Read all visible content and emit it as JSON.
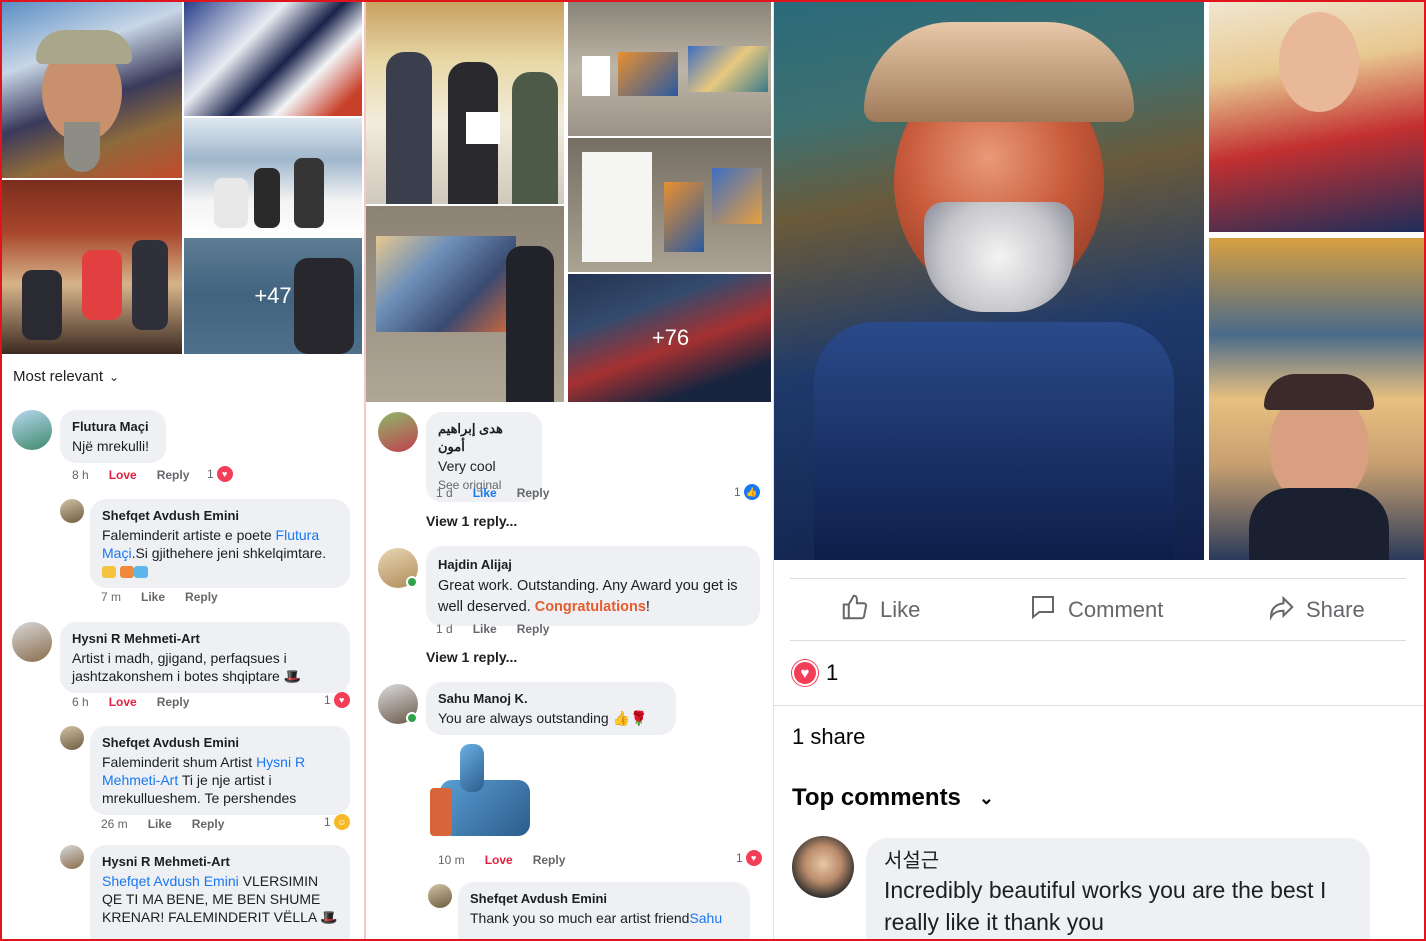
{
  "panel1": {
    "overlay_count": "+47",
    "sort_label": "Most relevant",
    "comments": [
      {
        "name": "Flutura Maçi",
        "text": "Një mrekulli!",
        "time": "8 h",
        "action1": "Love",
        "action2": "Reply",
        "reactions": "1"
      },
      {
        "name": "Shefqet Avdush Emini",
        "text_pre": "Faleminderit artiste e poete ",
        "mention": "Flutura Maçi",
        "text_post": ".Si gjithehere jeni shkelqimtare.",
        "time": "7 m",
        "action1": "Like",
        "action2": "Reply"
      },
      {
        "name": "Hysni R Mehmeti-Art",
        "text": "Artist i madh, gjigand, perfaqsues i jashtzakonshem i botes shqiptare",
        "time": "6 h",
        "action1": "Love",
        "action2": "Reply",
        "reactions": "1"
      },
      {
        "name": "Shefqet Avdush Emini",
        "text_pre": "Faleminderit shum Artist ",
        "mention": "Hysni R Mehmeti-Art",
        "text_post": " Ti je nje artist i mrekullueshem.",
        "text_tail": "Te pershendes",
        "time": "26 m",
        "action1": "Like",
        "action2": "Reply",
        "reactions": "1"
      },
      {
        "name": "Hysni R Mehmeti-Art",
        "mention": "Shefqet Avdush Emini",
        "text_post": " VLERSIMIN QE TI MA BENE, ME BEN SHUME KRENAR! FALEMINDERIT VËLLA"
      }
    ]
  },
  "panel2": {
    "overlay_count": "+76",
    "comments": [
      {
        "name": "هدى إبراهيم أمون",
        "text": "Very cool",
        "see": "See original",
        "time": "1 d",
        "action1": "Like",
        "action2": "Reply",
        "reactions": "1"
      },
      {
        "name": "Hajdin Alijaj",
        "text_pre": "Great work. Outstanding. Any Award you get is well deserved. ",
        "highlight": "Congratulations",
        "text_post": "!",
        "time": "1 d",
        "action1": "Like",
        "action2": "Reply"
      },
      {
        "name": "Sahu Manoj K.",
        "text": "You are always outstanding",
        "time": "10 m",
        "action1": "Love",
        "action2": "Reply",
        "reactions": "1"
      },
      {
        "name": "Shefqet Avdush Emini",
        "text_pre": "Thank you so much ear artist friend",
        "mention": "Sahu"
      }
    ],
    "view_reply": "View 1 reply..."
  },
  "panel3": {
    "actions": {
      "like": "Like",
      "comment": "Comment",
      "share": "Share"
    },
    "reaction_count": "1",
    "shares": "1 share",
    "sort_label": "Top comments",
    "comment": {
      "name": "서설근",
      "text": "Incredibly beautiful works you are the best I really like it thank you"
    }
  },
  "colors": {
    "accent": "#1877f2",
    "love": "#e41e3f",
    "frame": "#e0141c",
    "bubble": "#eef0f3"
  }
}
